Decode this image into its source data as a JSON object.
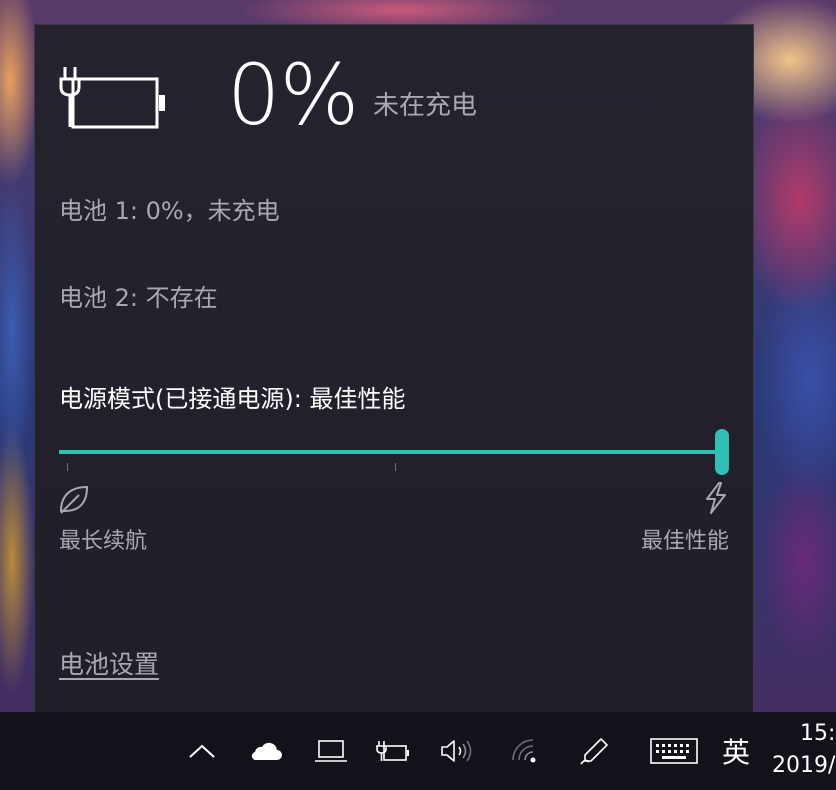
{
  "battery": {
    "percentage": "0%",
    "charge_state": "未在充电",
    "level_fraction": 0
  },
  "batteries": [
    {
      "text": "电池 1: 0%，未充电"
    },
    {
      "text": "电池 2: 不存在"
    }
  ],
  "power_mode": {
    "title": "电源模式(已接通电源): 最佳性能",
    "min_label": "最长续航",
    "max_label": "最佳性能",
    "slider_value_fraction": 1.0,
    "accent_color": "#2fbfb4"
  },
  "settings_link": "电池设置",
  "taskbar": {
    "icons": [
      "chevron-up-icon",
      "onedrive-cloud-icon",
      "laptop-icon",
      "battery-plugged-icon",
      "volume-icon",
      "wifi-icon",
      "pen-icon",
      "touch-keyboard-icon"
    ],
    "ime": "英",
    "clock": {
      "time": "15:",
      "date": "2019/"
    }
  }
}
